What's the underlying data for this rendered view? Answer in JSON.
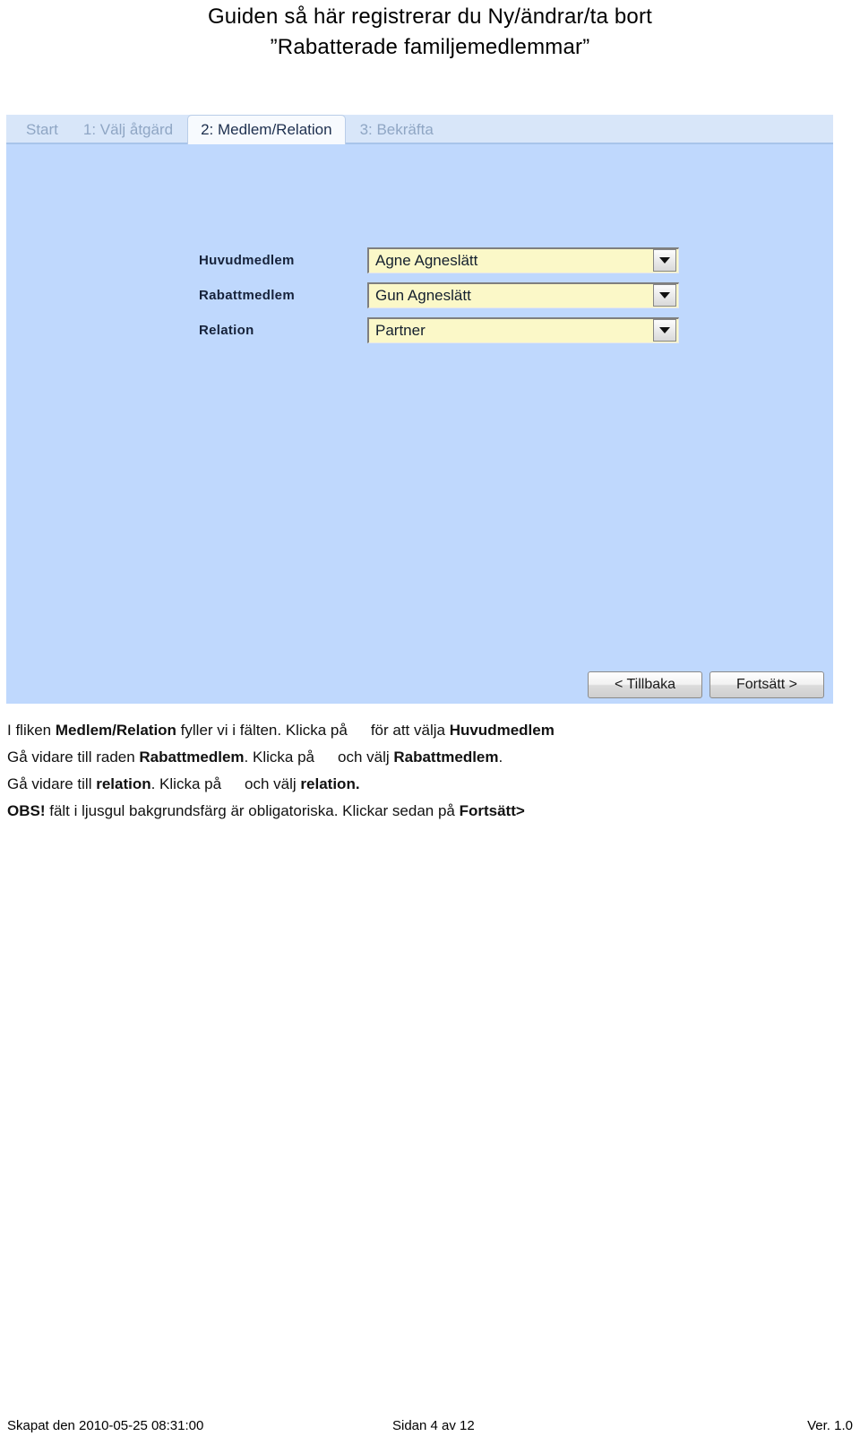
{
  "heading": {
    "line1": "Guiden så här registrerar du Ny/ändrar/ta bort",
    "line2": "”Rabatterade familjemedlemmar”"
  },
  "screenshot": {
    "tabs": [
      {
        "label": "Start",
        "active": false
      },
      {
        "label": "1: Välj åtgärd",
        "active": false
      },
      {
        "label": "2: Medlem/Relation",
        "active": true
      },
      {
        "label": "3: Bekräfta",
        "active": false
      }
    ],
    "form": {
      "rows": [
        {
          "label": "Huvudmedlem",
          "value": "Agne Agneslätt",
          "icon": "chevron-down-icon"
        },
        {
          "label": "Rabattmedlem",
          "value": "Gun Agneslätt",
          "icon": "chevron-down-icon"
        },
        {
          "label": "Relation",
          "value": "Partner",
          "icon": "chevron-down-icon"
        }
      ]
    },
    "buttons": {
      "back": "< Tillbaka",
      "next": "Fortsätt >"
    },
    "colors": {
      "panel_background": "#bfd8fd",
      "tabstrip_background": "#d8e6f9",
      "active_tab_background": "#f7fafe",
      "mandatory_field_background": "#fbf8c8"
    }
  },
  "instructions": {
    "p1_a": "I fliken ",
    "p1_b": "Medlem/Relation",
    "p1_c": " fyller vi i fälten. Klicka på",
    "p1_d": "för att välja ",
    "p1_e": "Huvudmedlem",
    "p2_a": "Gå vidare till raden ",
    "p2_b": "Rabattmedlem",
    "p2_c": ". Klicka på",
    "p2_d": "och välj ",
    "p2_e": "Rabattmedlem",
    "p2_f": ".",
    "p3_a": "Gå vidare till ",
    "p3_b": "relation",
    "p3_c": ". Klicka på",
    "p3_d": "och välj ",
    "p3_e": "relation.",
    "p4_a": "OBS!",
    "p4_b": " fält i ljusgul bakgrundsfärg är obligatoriska. Klickar sedan på ",
    "p4_c": "Fortsätt>"
  },
  "footer": {
    "created": "Skapat den 2010-05-25 08:31:00",
    "page": "Sidan 4 av 12",
    "version": "Ver. 1.0"
  }
}
